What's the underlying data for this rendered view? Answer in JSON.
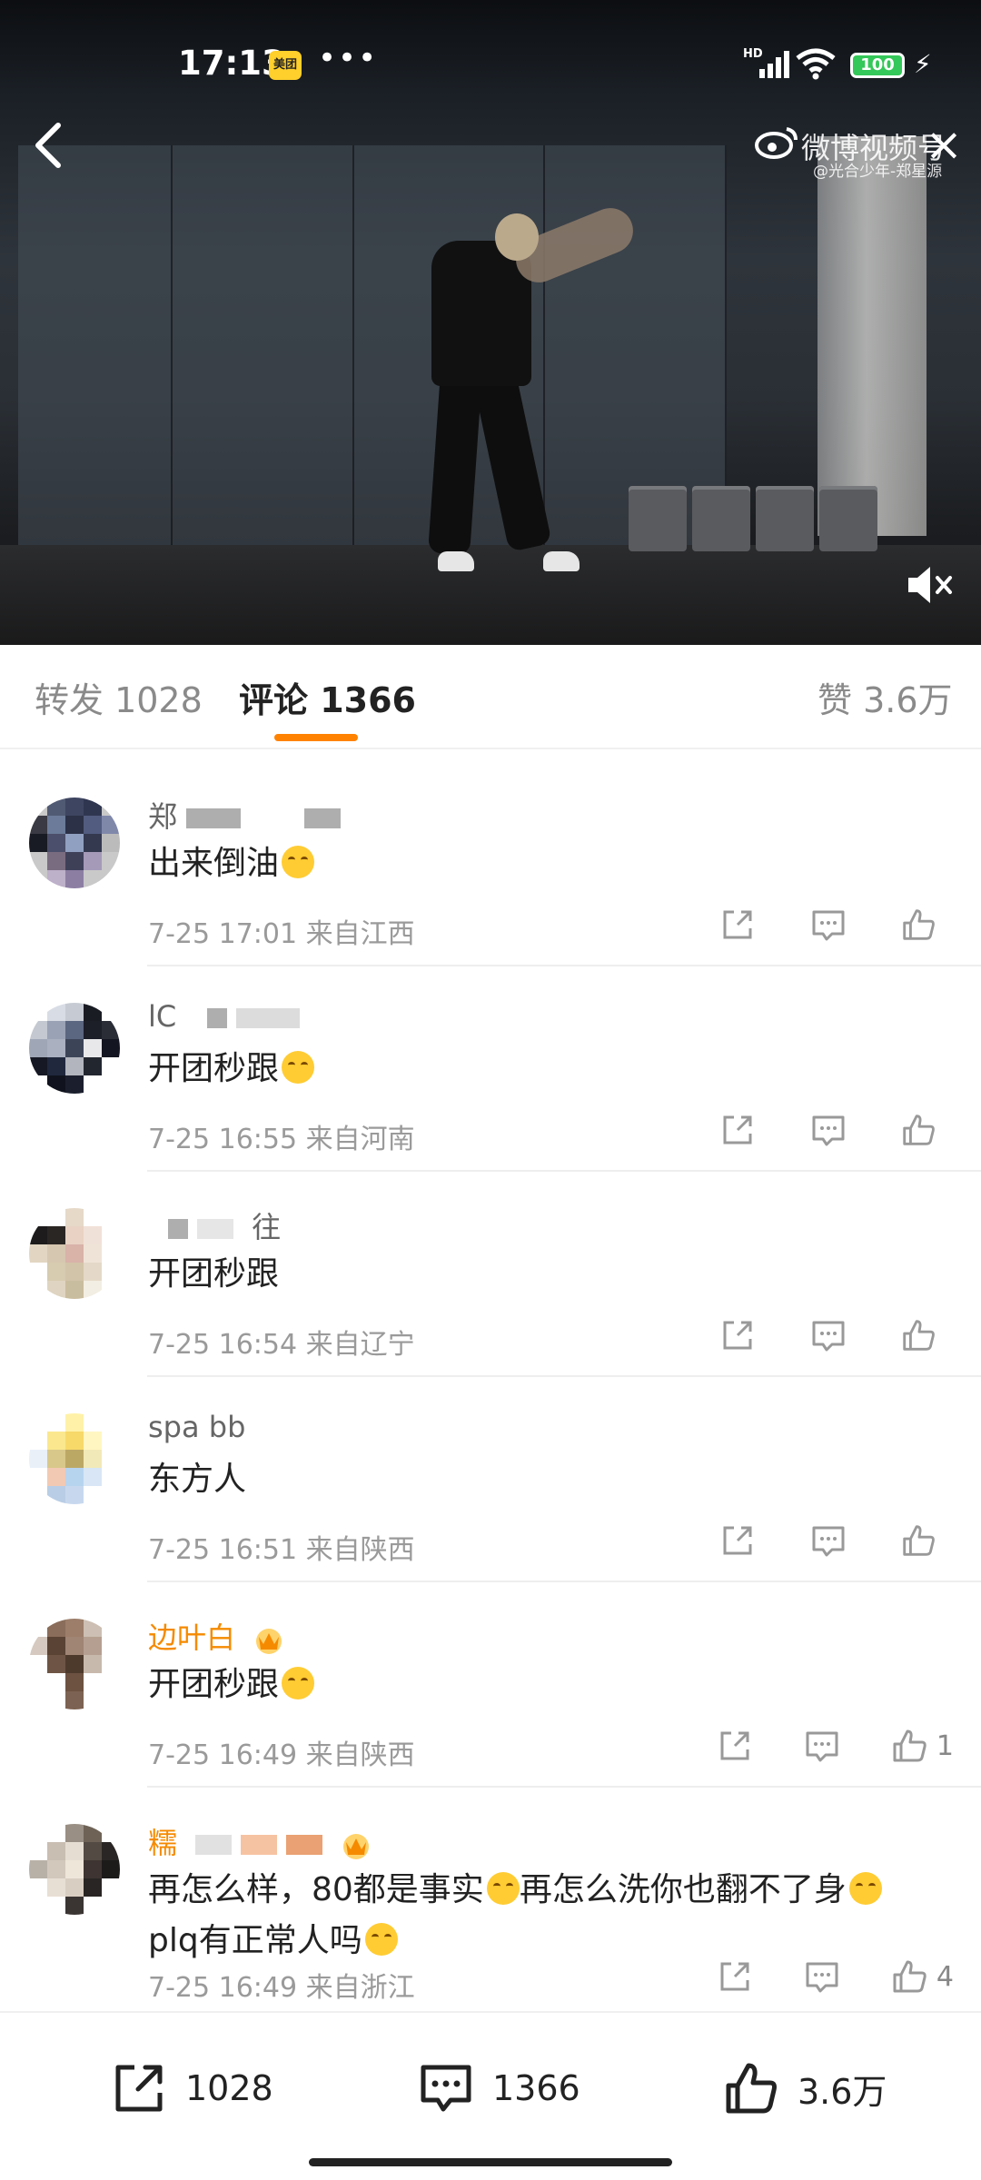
{
  "status_bar": {
    "time": "17:13",
    "app_badge": "美团",
    "more_indicator": "•••",
    "network": "HD",
    "battery": "100"
  },
  "video": {
    "watermark_main": "微博视频号",
    "watermark_sub": "@光合少年-郑星源"
  },
  "tabs": {
    "repost": "转发 1028",
    "comment": "评论 1366",
    "like": "赞 3.6万",
    "accent_color": "#ff8200"
  },
  "comments": [
    {
      "username": "郑",
      "text": "出来倒油",
      "meta": "7-25 17:01 来自江西",
      "likes": ""
    },
    {
      "username": "lC",
      "text": "开团秒跟",
      "meta": "7-25 16:55 来自河南",
      "likes": ""
    },
    {
      "username": "往",
      "text": "开团秒跟",
      "meta": "7-25 16:54 来自辽宁",
      "likes": ""
    },
    {
      "username": "spa bb",
      "text": "东方人",
      "meta": "7-25 16:51 来自陕西",
      "likes": ""
    },
    {
      "username": "边叶白",
      "text": "开团秒跟",
      "meta": "7-25 16:49 来自陕西",
      "likes": "1"
    },
    {
      "username": "糯",
      "text": "再怎么样，80都是事实",
      "text2": "再怎么洗你也翻不了身",
      "text3": "plq有正常人吗",
      "meta": "7-25 16:49 来自浙江",
      "likes": "4"
    }
  ],
  "bottom_bar": {
    "repost": "1028",
    "comment": "1366",
    "like": "3.6万"
  },
  "icons": {
    "back": "chevron-left-icon",
    "close": "close-icon",
    "mute": "speaker-muted-icon",
    "repost": "share-out-icon",
    "comment": "comment-bubble-icon",
    "like": "thumbs-up-icon"
  }
}
